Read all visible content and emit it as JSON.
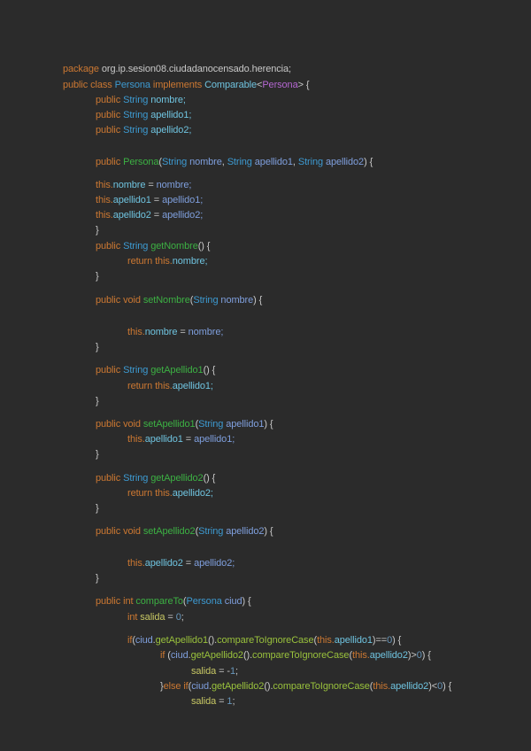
{
  "code_lines": [
    {
      "indent": 0,
      "tokens": [
        [
          "package ",
          "k"
        ],
        [
          "org.ip.sesion08.ciudadanocensado.herencia;",
          "d"
        ]
      ]
    },
    {
      "indent": 0,
      "tokens": [
        [
          "public class ",
          "k"
        ],
        [
          "Persona ",
          "t"
        ],
        [
          "implements ",
          "k"
        ],
        [
          "Comparable",
          "f"
        ],
        [
          "<",
          "d"
        ],
        [
          "Persona",
          "g"
        ],
        [
          "> {",
          "d"
        ]
      ]
    },
    {
      "indent": 1,
      "tokens": [
        [
          "public ",
          "k"
        ],
        [
          "String ",
          "t"
        ],
        [
          "nombre;",
          "f"
        ]
      ]
    },
    {
      "indent": 1,
      "tokens": [
        [
          "public ",
          "k"
        ],
        [
          "String ",
          "t"
        ],
        [
          "apellido1;",
          "f"
        ]
      ]
    },
    {
      "indent": 1,
      "tokens": [
        [
          "public ",
          "k"
        ],
        [
          "String ",
          "t"
        ],
        [
          "apellido2;",
          "f"
        ]
      ]
    },
    {
      "indent": 1,
      "tokens": [
        [
          "public ",
          "k"
        ],
        [
          "Persona",
          "m"
        ],
        [
          "(",
          "d"
        ],
        [
          "String ",
          "t"
        ],
        [
          "nombre",
          "p"
        ],
        [
          ", ",
          "d"
        ],
        [
          "String ",
          "t"
        ],
        [
          "apellido1",
          "p"
        ],
        [
          ", ",
          "d"
        ],
        [
          "String ",
          "t"
        ],
        [
          "apellido2",
          "p"
        ],
        [
          ") {",
          "d"
        ]
      ]
    },
    {
      "indent": 1,
      "tokens": [
        [
          "this.",
          "k"
        ],
        [
          "nombre",
          "f"
        ],
        [
          " = ",
          "d"
        ],
        [
          "nombre;",
          "p"
        ]
      ]
    },
    {
      "indent": 1,
      "tokens": [
        [
          "this.",
          "k"
        ],
        [
          "apellido1",
          "f"
        ],
        [
          " = ",
          "d"
        ],
        [
          "apellido1;",
          "p"
        ]
      ]
    },
    {
      "indent": 1,
      "tokens": [
        [
          "this.",
          "k"
        ],
        [
          "apellido2",
          "f"
        ],
        [
          " = ",
          "d"
        ],
        [
          "apellido2;",
          "p"
        ]
      ]
    },
    {
      "indent": 1,
      "tokens": [
        [
          "}",
          "d"
        ]
      ]
    },
    {
      "indent": 1,
      "tokens": [
        [
          "public ",
          "k"
        ],
        [
          "String ",
          "t"
        ],
        [
          "getNombre",
          "m"
        ],
        [
          "() {",
          "d"
        ]
      ]
    },
    {
      "indent": 2,
      "tokens": [
        [
          "return this.",
          "k"
        ],
        [
          "nombre;",
          "f"
        ]
      ]
    },
    {
      "indent": 1,
      "tokens": [
        [
          "}",
          "d"
        ]
      ]
    },
    {
      "indent": 1,
      "tokens": [
        [
          "public void ",
          "k"
        ],
        [
          "setNombre",
          "m"
        ],
        [
          "(",
          "d"
        ],
        [
          "String ",
          "t"
        ],
        [
          "nombre",
          "p"
        ],
        [
          ") {",
          "d"
        ]
      ]
    },
    {
      "indent": 2,
      "tokens": [
        [
          "this.",
          "k"
        ],
        [
          "nombre",
          "f"
        ],
        [
          " = ",
          "d"
        ],
        [
          "nombre;",
          "p"
        ]
      ]
    },
    {
      "indent": 1,
      "tokens": [
        [
          "}",
          "d"
        ]
      ]
    },
    {
      "indent": 1,
      "tokens": [
        [
          "public ",
          "k"
        ],
        [
          "String ",
          "t"
        ],
        [
          "getApellido1",
          "m"
        ],
        [
          "() {",
          "d"
        ]
      ]
    },
    {
      "indent": 2,
      "tokens": [
        [
          "return this.",
          "k"
        ],
        [
          "apellido1;",
          "f"
        ]
      ]
    },
    {
      "indent": 1,
      "tokens": [
        [
          "}",
          "d"
        ]
      ]
    },
    {
      "indent": 1,
      "tokens": [
        [
          "public void ",
          "k"
        ],
        [
          "setApellido1",
          "m"
        ],
        [
          "(",
          "d"
        ],
        [
          "String ",
          "t"
        ],
        [
          "apellido1",
          "p"
        ],
        [
          ") {",
          "d"
        ]
      ]
    },
    {
      "indent": 2,
      "tokens": [
        [
          "this.",
          "k"
        ],
        [
          "apellido1",
          "f"
        ],
        [
          " = ",
          "d"
        ],
        [
          "apellido1;",
          "p"
        ]
      ]
    },
    {
      "indent": 1,
      "tokens": [
        [
          "}",
          "d"
        ]
      ]
    },
    {
      "indent": 1,
      "tokens": [
        [
          "public ",
          "k"
        ],
        [
          "String ",
          "t"
        ],
        [
          "getApellido2",
          "m"
        ],
        [
          "() {",
          "d"
        ]
      ]
    },
    {
      "indent": 2,
      "tokens": [
        [
          "return this.",
          "k"
        ],
        [
          "apellido2;",
          "f"
        ]
      ]
    },
    {
      "indent": 1,
      "tokens": [
        [
          "}",
          "d"
        ]
      ]
    },
    {
      "indent": 1,
      "tokens": [
        [
          "public void ",
          "k"
        ],
        [
          "setApellido2",
          "m"
        ],
        [
          "(",
          "d"
        ],
        [
          "String ",
          "t"
        ],
        [
          "apellido2",
          "p"
        ],
        [
          ") {",
          "d"
        ]
      ]
    },
    {
      "indent": 2,
      "tokens": [
        [
          "this.",
          "k"
        ],
        [
          "apellido2",
          "f"
        ],
        [
          " = ",
          "d"
        ],
        [
          "apellido2;",
          "p"
        ]
      ]
    },
    {
      "indent": 1,
      "tokens": [
        [
          "}",
          "d"
        ]
      ]
    },
    {
      "indent": 1,
      "tokens": [
        [
          "public int ",
          "k"
        ],
        [
          "compareTo",
          "m"
        ],
        [
          "(",
          "d"
        ],
        [
          "Persona ",
          "t"
        ],
        [
          "ciud",
          "p"
        ],
        [
          ") {",
          "d"
        ]
      ]
    },
    {
      "indent": 2,
      "tokens": [
        [
          "int ",
          "k"
        ],
        [
          "salida",
          "v"
        ],
        [
          " = ",
          "d"
        ],
        [
          "0",
          "n"
        ],
        [
          ";",
          "d"
        ]
      ]
    },
    {
      "indent": 2,
      "tokens": [
        [
          "if",
          "k"
        ],
        [
          "(",
          "d"
        ],
        [
          "ciud",
          "p"
        ],
        [
          ".",
          "d"
        ],
        [
          "getApellido1",
          "c"
        ],
        [
          "().",
          "d"
        ],
        [
          "compareToIgnoreCase",
          "c"
        ],
        [
          "(",
          "d"
        ],
        [
          "this.",
          "k"
        ],
        [
          "apellido1",
          "f"
        ],
        [
          ")==",
          "d"
        ],
        [
          "0",
          "n"
        ],
        [
          ") {",
          "d"
        ]
      ]
    },
    {
      "indent": 3,
      "tokens": [
        [
          "if ",
          "k"
        ],
        [
          "(",
          "d"
        ],
        [
          "ciud",
          "p"
        ],
        [
          ".",
          "d"
        ],
        [
          "getApellido2",
          "c"
        ],
        [
          "().",
          "d"
        ],
        [
          "compareToIgnoreCase",
          "c"
        ],
        [
          "(",
          "d"
        ],
        [
          "this.",
          "k"
        ],
        [
          "apellido2",
          "f"
        ],
        [
          ")>",
          "d"
        ],
        [
          "0",
          "n"
        ],
        [
          ") {",
          "d"
        ]
      ]
    },
    {
      "indent": 4,
      "tokens": [
        [
          "salida",
          "v"
        ],
        [
          " = -",
          "d"
        ],
        [
          "1",
          "n"
        ],
        [
          ";",
          "d"
        ]
      ]
    },
    {
      "indent": 3,
      "tokens": [
        [
          "}",
          "d"
        ],
        [
          "else if",
          "k"
        ],
        [
          "(",
          "d"
        ],
        [
          "ciud",
          "p"
        ],
        [
          ".",
          "d"
        ],
        [
          "getApellido2",
          "c"
        ],
        [
          "().",
          "d"
        ],
        [
          "compareToIgnoreCase",
          "c"
        ],
        [
          "(",
          "d"
        ],
        [
          "this.",
          "k"
        ],
        [
          "apellido2",
          "f"
        ],
        [
          ")<",
          "d"
        ],
        [
          "0",
          "n"
        ],
        [
          ") {",
          "d"
        ]
      ]
    },
    {
      "indent": 4,
      "tokens": [
        [
          "salida",
          "v"
        ],
        [
          " = ",
          "d"
        ],
        [
          "1",
          "n"
        ],
        [
          ";",
          "d"
        ]
      ]
    }
  ]
}
